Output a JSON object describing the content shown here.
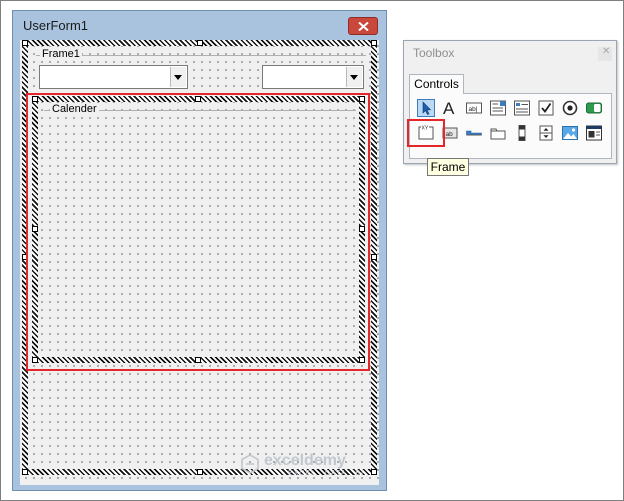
{
  "userform": {
    "title": "UserForm1",
    "frame1_caption": "Frame1",
    "calendar_frame_caption": "Calender"
  },
  "toolbox": {
    "title": "Toolbox",
    "tab_label": "Controls",
    "tooltip": "Frame",
    "tools": [
      {
        "name": "select-objects-icon",
        "selected": true
      },
      {
        "name": "label-icon"
      },
      {
        "name": "textbox-icon"
      },
      {
        "name": "combobox-icon"
      },
      {
        "name": "listbox-icon"
      },
      {
        "name": "checkbox-icon"
      },
      {
        "name": "optionbutton-icon"
      },
      {
        "name": "togglebutton-icon"
      },
      {
        "name": "frame-icon",
        "highlighted": true
      },
      {
        "name": "commandbutton-icon"
      },
      {
        "name": "tabstrip-icon"
      },
      {
        "name": "multipage-icon"
      },
      {
        "name": "scrollbar-icon"
      },
      {
        "name": "spinbutton-icon"
      },
      {
        "name": "image-icon"
      },
      {
        "name": "refedit-icon"
      }
    ]
  },
  "watermark": {
    "main": "exceldemy",
    "sub": "EXCEL · DATA · BI"
  },
  "colors": {
    "highlight_red": "#e5262a",
    "selection_blue": "#bcd8f2",
    "window_frame": "#a9c3de"
  }
}
